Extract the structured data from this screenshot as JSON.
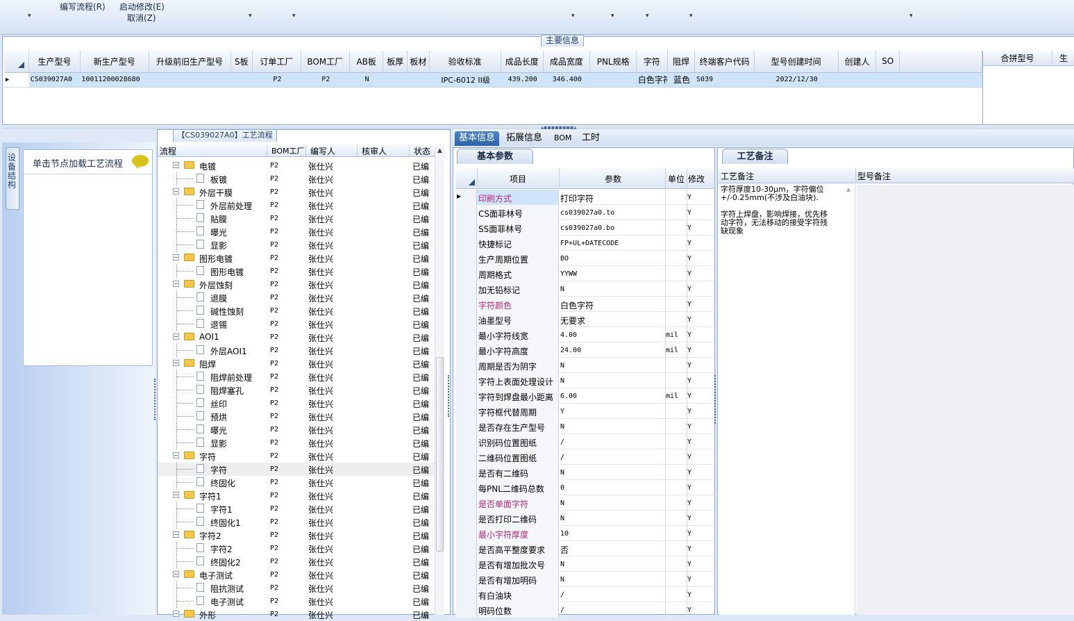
{
  "toolbar": {
    "edit_process": "编写流程(R)",
    "start_modify": "启动修改(E)",
    "cancel": "取消(Z)"
  },
  "main_info": {
    "title": "主要信息",
    "columns": [
      "生产型号",
      "新生产型号",
      "升级前旧生产型号",
      "S板",
      "订单工厂",
      "BOM工厂",
      "AB板",
      "板厚",
      "板材",
      "验收标准",
      "成品长度",
      "成品宽度",
      "PNL规格",
      "字符",
      "阻焊",
      "终端客户代码",
      "型号创建时间",
      "创建人",
      "SO"
    ],
    "row": [
      "CS039027A0",
      "10011200028680",
      "",
      "",
      "P2",
      "P2",
      "N",
      "",
      "",
      "IPC-6012 II级",
      "439.200",
      "346.400",
      "",
      "白色字符",
      "蓝色",
      "S039",
      "2022/12/30",
      "",
      ""
    ],
    "merge_columns": [
      "合拼型号",
      "生"
    ]
  },
  "left_panel": {
    "vertical_tab": "设备结构",
    "hint": "单击节点加载工艺流程"
  },
  "process": {
    "title": "【CS039027A0】工艺流程",
    "columns": [
      "流程",
      "BOM工厂",
      "编写人",
      "核审人",
      "状态"
    ],
    "rows": [
      {
        "name": "电镀",
        "level": 0,
        "factory": "P2",
        "writer": "张仕兴",
        "status": "已编"
      },
      {
        "name": "板镀",
        "level": 1,
        "factory": "P2",
        "writer": "张仕兴",
        "status": "已编"
      },
      {
        "name": "外层干膜",
        "level": 0,
        "factory": "P2",
        "writer": "张仕兴",
        "status": "已编"
      },
      {
        "name": "外层前处理",
        "level": 1,
        "factory": "P2",
        "writer": "张仕兴",
        "status": "已编"
      },
      {
        "name": "贴膜",
        "level": 1,
        "factory": "P2",
        "writer": "张仕兴",
        "status": "已编"
      },
      {
        "name": "曝光",
        "level": 1,
        "factory": "P2",
        "writer": "张仕兴",
        "status": "已编"
      },
      {
        "name": "显影",
        "level": 1,
        "factory": "P2",
        "writer": "张仕兴",
        "status": "已编"
      },
      {
        "name": "图形电镀",
        "level": 0,
        "factory": "P2",
        "writer": "张仕兴",
        "status": "已编"
      },
      {
        "name": "图形电镀",
        "level": 1,
        "factory": "P2",
        "writer": "张仕兴",
        "status": "已编"
      },
      {
        "name": "外层蚀刻",
        "level": 0,
        "factory": "P2",
        "writer": "张仕兴",
        "status": "已编"
      },
      {
        "name": "退膜",
        "level": 1,
        "factory": "P2",
        "writer": "张仕兴",
        "status": "已编"
      },
      {
        "name": "碱性蚀刻",
        "level": 1,
        "factory": "P2",
        "writer": "张仕兴",
        "status": "已编"
      },
      {
        "name": "退锡",
        "level": 1,
        "factory": "P2",
        "writer": "张仕兴",
        "status": "已编"
      },
      {
        "name": "AOI1",
        "level": 0,
        "factory": "P2",
        "writer": "张仕兴",
        "status": "已编"
      },
      {
        "name": "外层AOI1",
        "level": 1,
        "factory": "P2",
        "writer": "张仕兴",
        "status": "已编"
      },
      {
        "name": "阻焊",
        "level": 0,
        "factory": "P2",
        "writer": "张仕兴",
        "status": "已编"
      },
      {
        "name": "阻焊前处理",
        "level": 1,
        "factory": "P2",
        "writer": "张仕兴",
        "status": "已编"
      },
      {
        "name": "阻焊塞孔",
        "level": 1,
        "factory": "P2",
        "writer": "张仕兴",
        "status": "已编"
      },
      {
        "name": "丝印",
        "level": 1,
        "factory": "P2",
        "writer": "张仕兴",
        "status": "已编"
      },
      {
        "name": "预烘",
        "level": 1,
        "factory": "P2",
        "writer": "张仕兴",
        "status": "已编"
      },
      {
        "name": "曝光",
        "level": 1,
        "factory": "P2",
        "writer": "张仕兴",
        "status": "已编"
      },
      {
        "name": "显影",
        "level": 1,
        "factory": "P2",
        "writer": "张仕兴",
        "status": "已编"
      },
      {
        "name": "字符",
        "level": 0,
        "factory": "P2",
        "writer": "张仕兴",
        "status": "已编"
      },
      {
        "name": "字符",
        "level": 1,
        "factory": "P2",
        "writer": "张仕兴",
        "status": "已编"
      },
      {
        "name": "终固化",
        "level": 1,
        "factory": "P2",
        "writer": "张仕兴",
        "status": "已编"
      },
      {
        "name": "字符1",
        "level": 0,
        "factory": "P2",
        "writer": "张仕兴",
        "status": "已编"
      },
      {
        "name": "字符1",
        "level": 1,
        "factory": "P2",
        "writer": "张仕兴",
        "status": "已编"
      },
      {
        "name": "终固化1",
        "level": 1,
        "factory": "P2",
        "writer": "张仕兴",
        "status": "已编"
      },
      {
        "name": "字符2",
        "level": 0,
        "factory": "P2",
        "writer": "张仕兴",
        "status": "已编"
      },
      {
        "name": "字符2",
        "level": 1,
        "factory": "P2",
        "writer": "张仕兴",
        "status": "已编"
      },
      {
        "name": "终固化2",
        "level": 1,
        "factory": "P2",
        "writer": "张仕兴",
        "status": "已编"
      },
      {
        "name": "电子测试",
        "level": 0,
        "factory": "P2",
        "writer": "张仕兴",
        "status": "已编"
      },
      {
        "name": "阻抗测试",
        "level": 1,
        "factory": "P2",
        "writer": "张仕兴",
        "status": "已编"
      },
      {
        "name": "电子测试",
        "level": 1,
        "factory": "P2",
        "writer": "张仕兴",
        "status": "已编"
      },
      {
        "name": "外形",
        "level": 0,
        "factory": "P2",
        "writer": "张仕兴",
        "status": "已编"
      }
    ]
  },
  "tabs": [
    "基本信息",
    "拓展信息",
    "BOM",
    "工时"
  ],
  "basic_params": {
    "title": "基本参数",
    "columns": [
      "项目",
      "参数",
      "单位",
      "修改"
    ],
    "rows": [
      {
        "item": "印刷方式",
        "value": "打印字符",
        "unit": "",
        "mod": "Y",
        "highlight": true
      },
      {
        "item": "CS面菲林号",
        "value": "cs039027a0.to",
        "unit": "",
        "mod": "Y",
        "highlight": false
      },
      {
        "item": "SS面菲林号",
        "value": "cs039027a0.bo",
        "unit": "",
        "mod": "Y",
        "highlight": false
      },
      {
        "item": "快捷标记",
        "value": "FP+UL+DATECODE",
        "unit": "",
        "mod": "Y",
        "highlight": false
      },
      {
        "item": "生产周期位置",
        "value": "BO",
        "unit": "",
        "mod": "Y",
        "highlight": false
      },
      {
        "item": "周期格式",
        "value": "YYWW",
        "unit": "",
        "mod": "Y",
        "highlight": false
      },
      {
        "item": "加无铅标记",
        "value": "N",
        "unit": "",
        "mod": "Y",
        "highlight": false
      },
      {
        "item": "字符颜色",
        "value": "白色字符",
        "unit": "",
        "mod": "Y",
        "highlight": true
      },
      {
        "item": "油墨型号",
        "value": "无要求",
        "unit": "",
        "mod": "Y",
        "highlight": false
      },
      {
        "item": "最小字符线宽",
        "value": "4.00",
        "unit": "mil",
        "mod": "Y",
        "highlight": false
      },
      {
        "item": "最小字符高度",
        "value": "24.00",
        "unit": "mil",
        "mod": "Y",
        "highlight": false
      },
      {
        "item": "周期是否为阴字",
        "value": "N",
        "unit": "",
        "mod": "Y",
        "highlight": false
      },
      {
        "item": "字符上表面处理设计",
        "value": "N",
        "unit": "",
        "mod": "Y",
        "highlight": false
      },
      {
        "item": "字符到焊盘最小距离",
        "value": "6.00",
        "unit": "mil",
        "mod": "Y",
        "highlight": false
      },
      {
        "item": "字符框代替周期",
        "value": "Y",
        "unit": "",
        "mod": "Y",
        "highlight": false
      },
      {
        "item": "是否存在生产型号",
        "value": "N",
        "unit": "",
        "mod": "Y",
        "highlight": false
      },
      {
        "item": "识别码位置图纸",
        "value": "/",
        "unit": "",
        "mod": "Y",
        "highlight": false
      },
      {
        "item": "二维码位置图纸",
        "value": "/",
        "unit": "",
        "mod": "Y",
        "highlight": false
      },
      {
        "item": "是否有二维码",
        "value": "N",
        "unit": "",
        "mod": "Y",
        "highlight": false
      },
      {
        "item": "每PNL二维码总数",
        "value": "0",
        "unit": "",
        "mod": "Y",
        "highlight": false
      },
      {
        "item": "是否单面字符",
        "value": "N",
        "unit": "",
        "mod": "Y",
        "highlight": true
      },
      {
        "item": "是否打印二维码",
        "value": "N",
        "unit": "",
        "mod": "Y",
        "highlight": false
      },
      {
        "item": "最小字符厚度",
        "value": "10",
        "unit": "",
        "mod": "Y",
        "highlight": true
      },
      {
        "item": "是否高平整度要求",
        "value": "否",
        "unit": "",
        "mod": "Y",
        "highlight": false
      },
      {
        "item": "是否有增加批次号",
        "value": "N",
        "unit": "",
        "mod": "Y",
        "highlight": false
      },
      {
        "item": "是否有增加明码",
        "value": "N",
        "unit": "",
        "mod": "Y",
        "highlight": false
      },
      {
        "item": "有白油块",
        "value": "/",
        "unit": "",
        "mod": "Y",
        "highlight": false
      },
      {
        "item": "明码位数",
        "value": "/",
        "unit": "",
        "mod": "Y",
        "highlight": false
      }
    ]
  },
  "remarks": {
    "title": "工艺备注",
    "col_process": "工艺备注",
    "col_model": "型号备注",
    "text_line1": "字符厚度10-30μm，字符偏位",
    "text_line2": "+/-0.25mm(不涉及白油块).",
    "text_line3": "字符上焊盘，影响焊接，优先移",
    "text_line4": "动字符，无法移动的接受字符残",
    "text_line5": "缺现象"
  },
  "colors": {
    "highlight_text": "#b0287c",
    "selected_row": "#cfe3f9",
    "active_tab": "#3a6fb5"
  }
}
